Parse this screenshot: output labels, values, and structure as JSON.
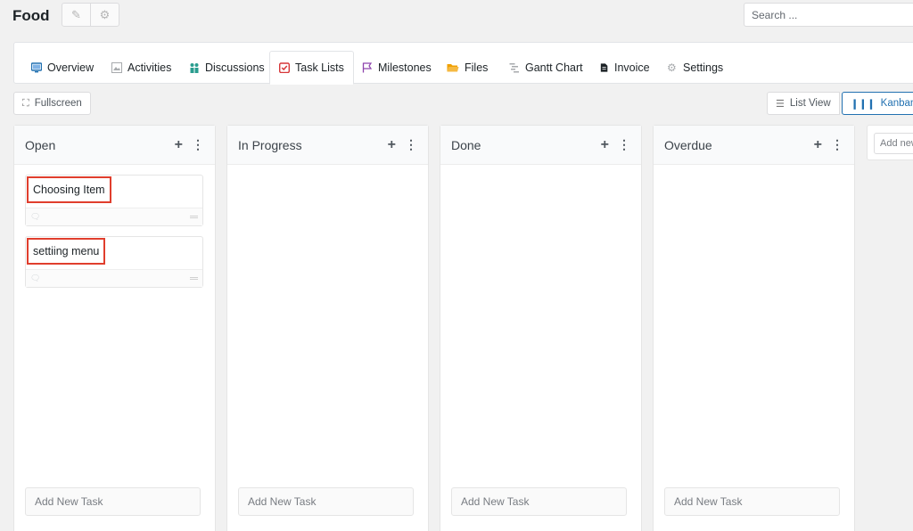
{
  "project": {
    "title": "Food"
  },
  "search": {
    "placeholder": "Search ..."
  },
  "tabs": [
    {
      "label": "Overview",
      "icon": "monitor-icon",
      "color": "#2271b1"
    },
    {
      "label": "Activities",
      "icon": "image-icon",
      "color": "#8c8f94"
    },
    {
      "label": "Discussions",
      "icon": "people-icon",
      "color": "#2a9d8f"
    },
    {
      "label": "Task Lists",
      "icon": "checklist-icon",
      "color": "#d63638",
      "active": true
    },
    {
      "label": "Milestones",
      "icon": "flag-icon",
      "color": "#8e44ad"
    },
    {
      "label": "Files",
      "icon": "folder-icon",
      "color": "#f0a000"
    },
    {
      "label": "Gantt Chart",
      "icon": "gantt-icon",
      "color": "#8c8f94"
    },
    {
      "label": "Invoice",
      "icon": "document-icon",
      "color": "#1d2327"
    },
    {
      "label": "Settings",
      "icon": "gear-icon",
      "color": "#8c8f94"
    }
  ],
  "toolbar": {
    "fullscreen": "Fullscreen",
    "list_view": "List View",
    "kanban": "Kanban"
  },
  "columns": [
    {
      "title": "Open",
      "add_task": "Add New Task",
      "cards": [
        {
          "title": "Choosing Item"
        },
        {
          "title": "settiing menu"
        }
      ]
    },
    {
      "title": "In Progress",
      "add_task": "Add New Task",
      "cards": []
    },
    {
      "title": "Done",
      "add_task": "Add New Task",
      "cards": []
    },
    {
      "title": "Overdue",
      "add_task": "Add New Task",
      "cards": []
    }
  ],
  "add_list": {
    "placeholder": "Add new list"
  }
}
